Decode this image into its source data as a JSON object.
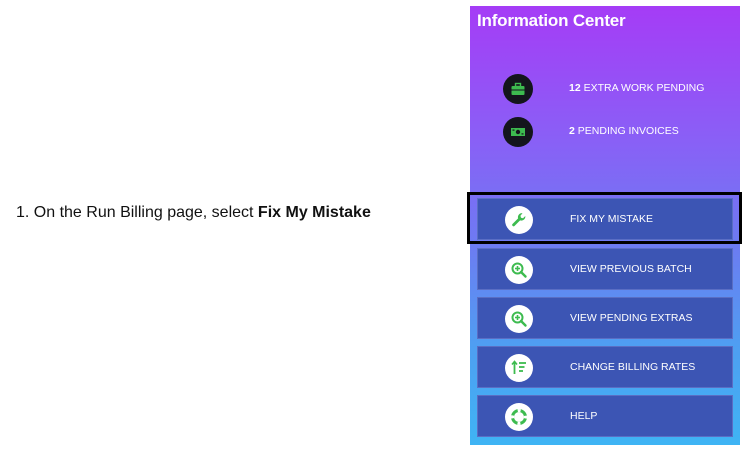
{
  "instruction": {
    "prefix": "1. On the Run Billing page, select ",
    "emphasis": "Fix My Mistake"
  },
  "panel": {
    "title": "Information Center",
    "stats": [
      {
        "count": "12",
        "label": "EXTRA WORK PENDING",
        "icon": "briefcase-icon"
      },
      {
        "count": "2",
        "label": "PENDING INVOICES",
        "icon": "money-icon"
      }
    ],
    "menu": [
      {
        "label": "FIX MY MISTAKE",
        "icon": "wrench-icon"
      },
      {
        "label": "VIEW PREVIOUS BATCH",
        "icon": "zoom-in-icon"
      },
      {
        "label": "VIEW PENDING EXTRAS",
        "icon": "zoom-in-icon"
      },
      {
        "label": "CHANGE BILLING RATES",
        "icon": "sort-icon"
      },
      {
        "label": "HELP",
        "icon": "lifebuoy-icon"
      }
    ]
  },
  "colors": {
    "icon_green": "#3dbb4f",
    "menu_bg": "#3c55b4",
    "highlight": "#000000"
  }
}
